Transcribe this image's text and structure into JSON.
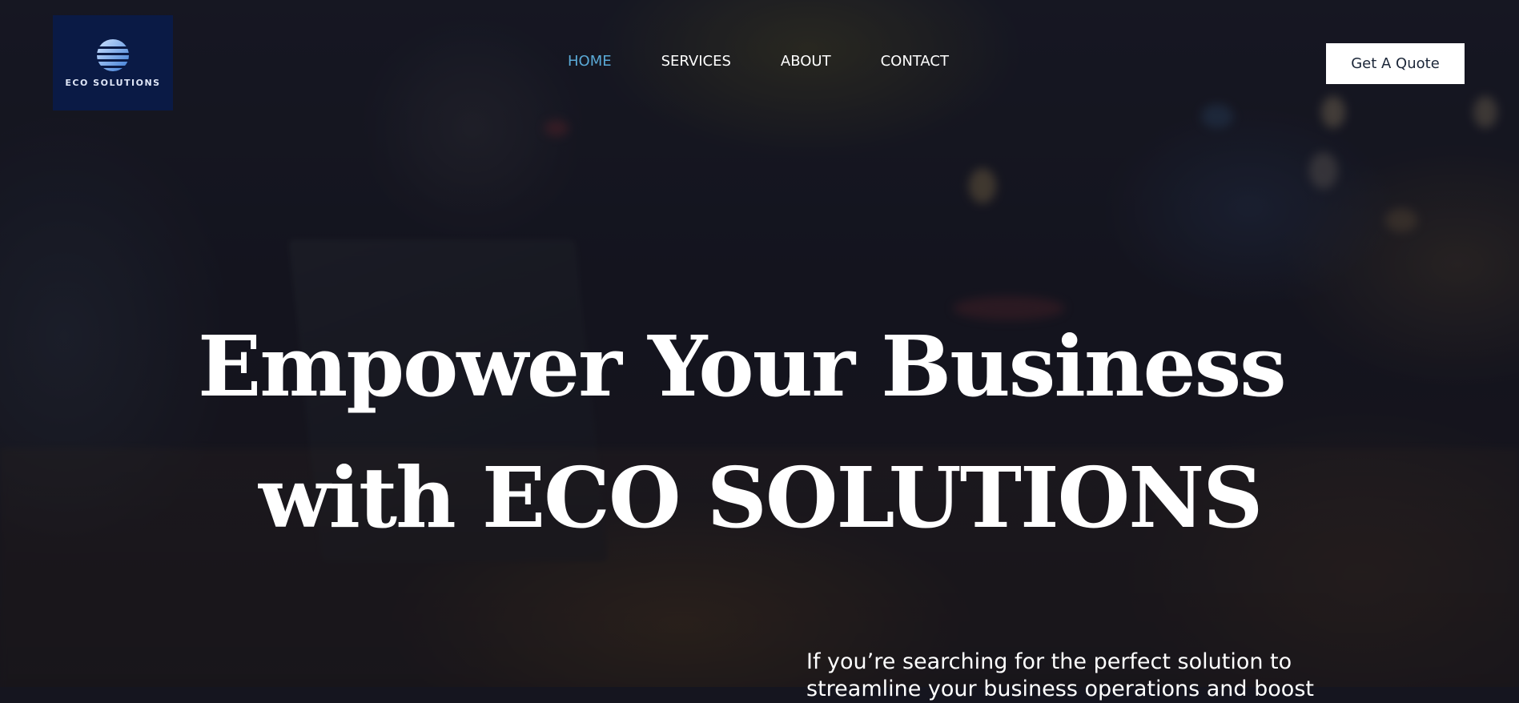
{
  "brand": {
    "logo_text": "ECO SOLUTIONS",
    "logo_bg": "#0a1a45",
    "icon": "globe-stripes-icon"
  },
  "nav": {
    "items": [
      {
        "label": "HOME",
        "active": true
      },
      {
        "label": "SERVICES",
        "active": false
      },
      {
        "label": "ABOUT",
        "active": false
      },
      {
        "label": "CONTACT",
        "active": false
      }
    ],
    "active_color": "#5aa9d6"
  },
  "header": {
    "cta_label": "Get A Quote"
  },
  "hero": {
    "title_line1": "Empower Your Business",
    "title_line2": "with ECO SOLUTIONS",
    "paragraph": "If you’re searching for the perfect solution to streamline your business operations and boost"
  }
}
